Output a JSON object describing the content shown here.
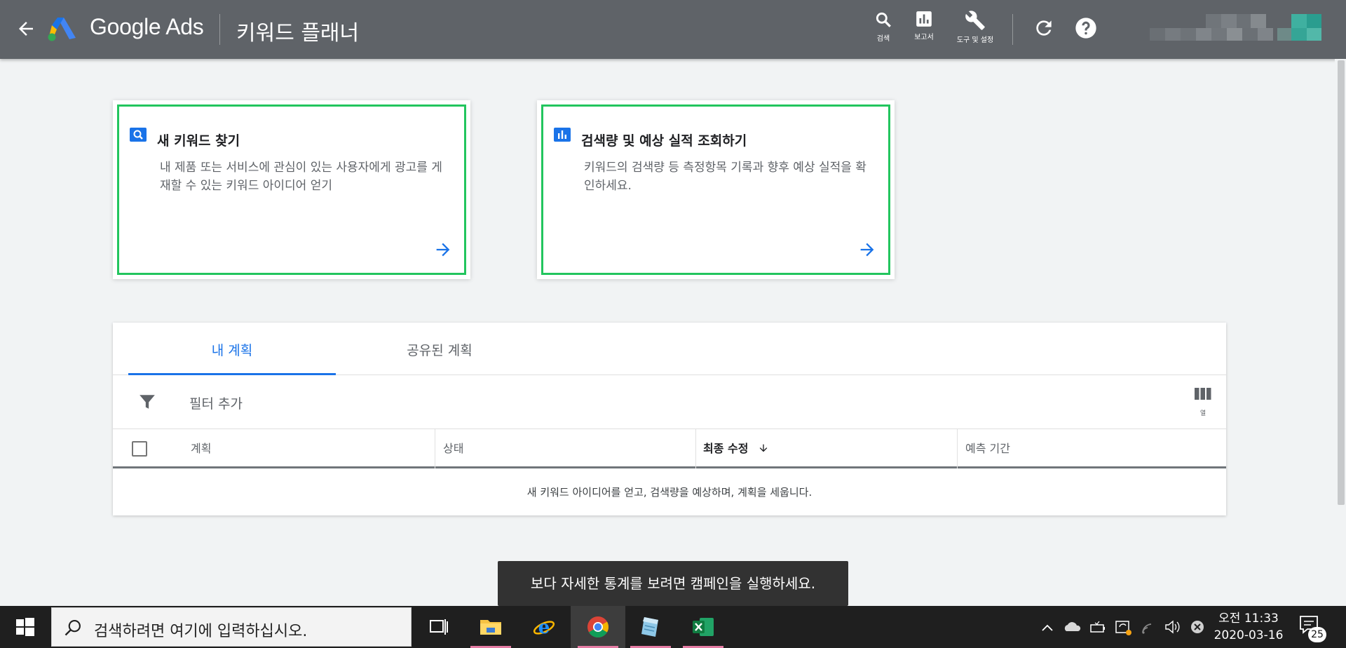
{
  "header": {
    "brand": "Google Ads",
    "page_title": "키워드 플래너",
    "tools": [
      {
        "label": "검색",
        "icon": "search-icon"
      },
      {
        "label": "보고서",
        "icon": "reports-icon"
      },
      {
        "label": "도구 및 설정",
        "icon": "wrench-icon"
      }
    ]
  },
  "cards": [
    {
      "title": "새 키워드 찾기",
      "description": "내 제품 또는 서비스에 관심이 있는 사용자에게 광고를 게재할 수 있는 키워드 아이디어 얻기",
      "icon": "search-icon"
    },
    {
      "title": "검색량 및 예상 실적 조회하기",
      "description": "키워드의 검색량 등 측정항목 기록과 향후 예상 실적을 확인하세요.",
      "icon": "bar-chart-icon"
    }
  ],
  "plans": {
    "tabs": [
      {
        "label": "내 계획",
        "active": true
      },
      {
        "label": "공유된 계획",
        "active": false
      }
    ],
    "filter_label": "필터 추가",
    "columns_label": "열",
    "table_headers": [
      "계획",
      "상태",
      "최종 수정",
      "예측 기간"
    ],
    "sort_column": "최종 수정",
    "empty_message": "새 키워드 아이디어를 얻고, 검색량을 예상하며, 계획을 세웁니다."
  },
  "toast": "보다 자세한 통계를 보려면 캠페인을 실행하세요.",
  "taskbar": {
    "search_placeholder": "검색하려면 여기에 입력하십시오.",
    "apps": [
      "task-view",
      "file-explorer",
      "internet-explorer",
      "chrome",
      "notepad",
      "excel"
    ],
    "time": "오전 11:33",
    "date": "2020-03-16",
    "notification_count": "25"
  },
  "colors": {
    "topbar": "#5f6368",
    "accent": "#1a73e8",
    "card_border": "#22c55e",
    "toast": "#323232",
    "taskbar": "#1f1f1f"
  }
}
